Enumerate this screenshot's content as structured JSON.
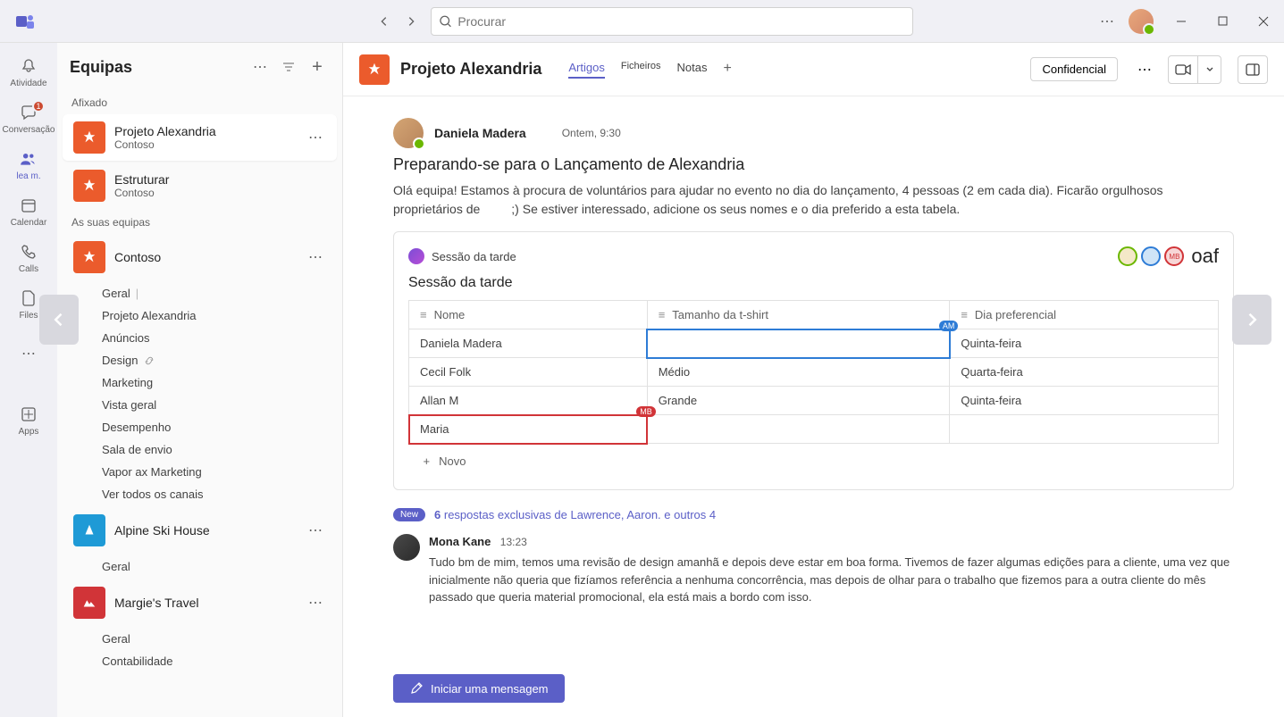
{
  "search": {
    "placeholder": "Procurar"
  },
  "rail": {
    "activity": "Atividade",
    "chat": "Conversação",
    "chat_badge": "1",
    "teams": "lea m.",
    "calendar": "Calendar",
    "calls": "Calls",
    "files": "Files",
    "apps": "Apps"
  },
  "sidebar": {
    "title": "Equipas",
    "section_pinned": "Afixado",
    "section_yours": "As suas equipas",
    "pinned": [
      {
        "name": "Projeto Alexandria",
        "sub": "Contoso",
        "color": "#eb5b2c"
      },
      {
        "name": "Estruturar",
        "sub": "Contoso",
        "color": "#eb5b2c"
      }
    ],
    "teams": [
      {
        "name": "Contoso",
        "color": "#eb5b2c",
        "channels": [
          "Geral",
          "Projeto Alexandria",
          "Anúncios",
          "Design",
          "Marketing",
          "Vista geral",
          "Desempenho",
          "Sala de envio",
          "Vapor ax Marketing",
          "Ver todos os canais"
        ]
      },
      {
        "name": "Alpine Ski House",
        "color": "#1e9ad6",
        "channels": [
          "Geral"
        ]
      },
      {
        "name": "Margie's Travel",
        "color": "#d13438",
        "channels": [
          "Geral",
          "Contabilidade"
        ]
      }
    ]
  },
  "header": {
    "title": "Projeto Alexandria",
    "tabs": {
      "t1": "Artigos",
      "t2": "Ficheiros",
      "t3": "Notas"
    },
    "confidential": "Confidencial"
  },
  "post": {
    "author": "Daniela Madera",
    "time": "Ontem, 9:30",
    "title": "Preparando-se para o Lançamento de Alexandria",
    "body_a": "Olá equipa! Estamos à procura de voluntários para ajudar no evento no dia do lançamento, 4 pessoas (2 em cada dia). Ficarão orgulhosos proprietários de ",
    "body_b": ";) Se estiver interessado, adicione os seus nomes e o dia preferido a esta tabela."
  },
  "embed": {
    "app_title": "Sessão da tarde",
    "code": "oaf",
    "subtitle": "Sessão da tarde",
    "presence": [
      {
        "bg": "#f4e8c8",
        "border": "#6bb700"
      },
      {
        "bg": "#cfe4f7",
        "border": "#2e7cd6"
      },
      {
        "bg": "#f7d6d6",
        "border": "#d13438",
        "txt": "MB"
      }
    ],
    "cols": {
      "c1": "Nome",
      "c2": "Tamanho da t-shirt",
      "c3": "Dia preferencial"
    },
    "rows": [
      {
        "name": "Daniela Madera",
        "size": "",
        "day": "Quinta-feira",
        "active_size": true,
        "badge": "AM"
      },
      {
        "name": "Cecil Folk",
        "size": "Médio",
        "day": "Quarta-feira"
      },
      {
        "name": "Allan M",
        "size": "Grande",
        "day": "Quinta-feira"
      },
      {
        "name": "Maria",
        "size": "",
        "day": "",
        "editing": true,
        "badge": "MB"
      }
    ],
    "add_row": "Novo"
  },
  "replies": {
    "pill": "New",
    "count": "6",
    "text": "respostas exclusivas de Lawrence, Aaron. e outros 4"
  },
  "reply1": {
    "author": "Mona Kane",
    "time": "13:23",
    "body": "Tudo bm de mim, temos uma revisão de design amanhã e depois deve estar em boa forma. Tivemos de fazer algumas edições para a cliente, uma vez que inicialmente não queria que fizíamos referência a nenhuma concorrência, mas depois de olhar para o trabalho que fizemos para a outra cliente do mês passado que queria material promocional, ela está mais a bordo com isso."
  },
  "compose": "Iniciar uma mensagem"
}
